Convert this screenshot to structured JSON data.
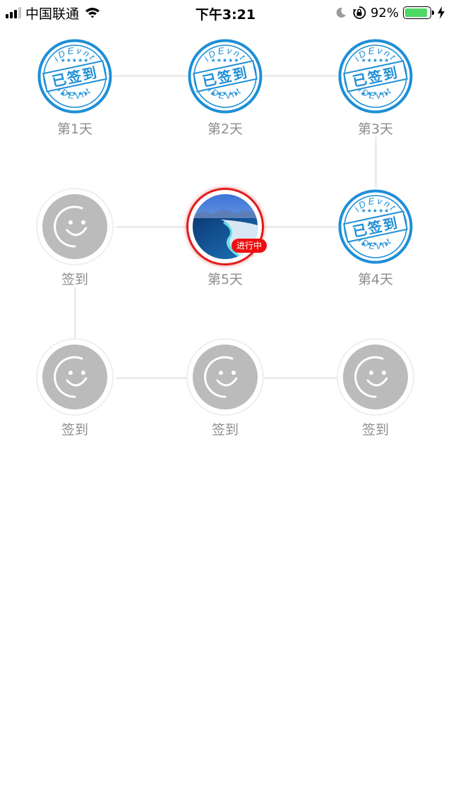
{
  "status_bar": {
    "carrier": "中国联通",
    "time": "下午3:21",
    "battery_percent": "92%",
    "battery_level": 0.92,
    "icons": [
      "signal-icon",
      "wifi-icon",
      "moon-icon",
      "orientation-lock-icon",
      "battery-icon",
      "charging-icon"
    ]
  },
  "checkin": {
    "stamp_text": "已签到",
    "stamp_brand": "iDEvnt",
    "days": [
      {
        "label": "第1天",
        "state": "signed"
      },
      {
        "label": "第2天",
        "state": "signed"
      },
      {
        "label": "第3天",
        "state": "signed"
      },
      {
        "label": "第4天",
        "state": "signed"
      },
      {
        "label": "第5天",
        "state": "active",
        "badge": "进行中"
      },
      {
        "label": "签到",
        "state": "pending"
      },
      {
        "label": "签到",
        "state": "pending"
      },
      {
        "label": "签到",
        "state": "pending"
      },
      {
        "label": "签到",
        "state": "pending"
      }
    ]
  },
  "colors": {
    "stamp_blue": "#1e8fd6",
    "active_red": "#e21b1b",
    "placeholder_gray": "#bbbbbb",
    "label_gray": "#8e8e8e",
    "connector": "#ececec"
  }
}
